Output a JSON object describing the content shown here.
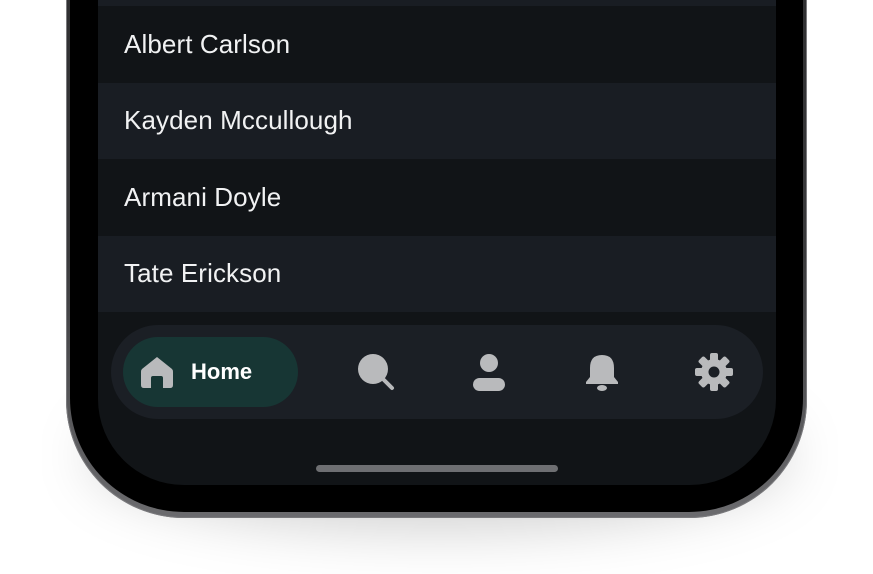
{
  "contacts": [
    {
      "name": "Albert Carlson"
    },
    {
      "name": "Kayden Mccullough"
    },
    {
      "name": "Armani Doyle"
    },
    {
      "name": "Tate Erickson"
    }
  ],
  "nav": {
    "items": [
      {
        "label": "Home",
        "icon": "home-icon",
        "active": true
      },
      {
        "label": "",
        "icon": "search-icon",
        "active": false
      },
      {
        "label": "",
        "icon": "profile-icon",
        "active": false
      },
      {
        "label": "",
        "icon": "bell-icon",
        "active": false
      },
      {
        "label": "",
        "icon": "gear-icon",
        "active": false
      }
    ]
  },
  "colors": {
    "accent": "#173634",
    "background": "#111417",
    "row_alt": "#191d23",
    "icon": "#b9babc",
    "text": "#f1f2f3"
  }
}
